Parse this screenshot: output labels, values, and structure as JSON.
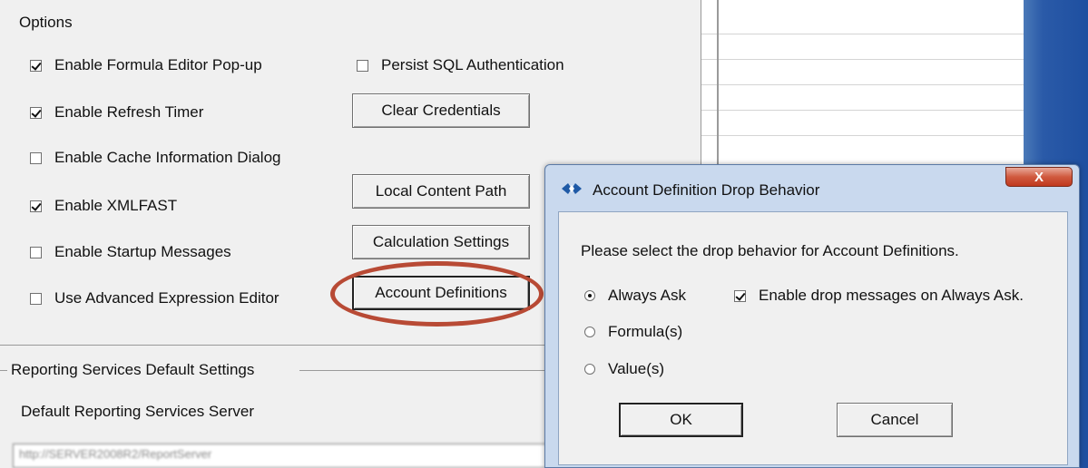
{
  "options": {
    "group_title": "Options",
    "checkboxes_left": [
      {
        "label": "Enable Formula Editor Pop-up",
        "checked": true
      },
      {
        "label": "Enable Refresh Timer",
        "checked": true
      },
      {
        "label": "Enable Cache Information Dialog",
        "checked": false
      },
      {
        "label": "Enable XMLFAST",
        "checked": true
      },
      {
        "label": "Enable Startup Messages",
        "checked": false
      },
      {
        "label": "Use Advanced Expression Editor",
        "checked": false
      }
    ],
    "persist_sql": {
      "label": "Persist SQL Authentication",
      "checked": false
    },
    "buttons": {
      "clear_credentials": "Clear Credentials",
      "local_content_path": "Local Content Path",
      "calculation_settings": "Calculation Settings",
      "account_definitions": "Account Definitions"
    },
    "highlight_color": "#b84a35"
  },
  "reporting": {
    "group_title": "Reporting Services Default Settings",
    "server_label": "Default Reporting Services Server",
    "server_value": "http://SERVER2008R2/ReportServer"
  },
  "dialog": {
    "title": "Account Definition Drop Behavior",
    "close_label": "X",
    "prompt": "Please select the drop behavior for Account Definitions.",
    "radios": [
      {
        "label": "Always Ask",
        "selected": true
      },
      {
        "label": "Formula(s)",
        "selected": false
      },
      {
        "label": "Value(s)",
        "selected": false
      }
    ],
    "enable_drop_messages": {
      "label": "Enable drop messages on Always Ask.",
      "checked": true
    },
    "ok_label": "OK",
    "cancel_label": "Cancel"
  }
}
